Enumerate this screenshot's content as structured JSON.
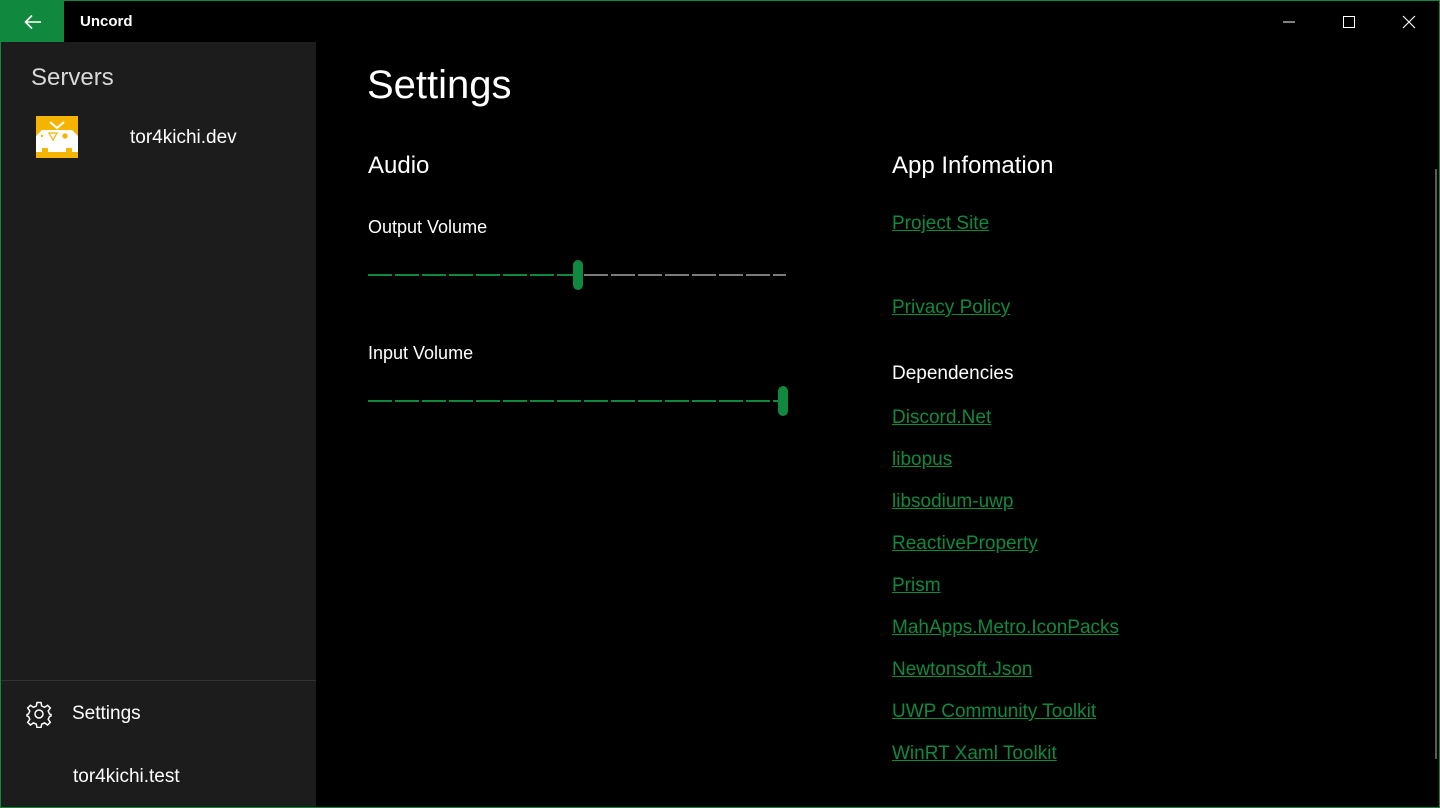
{
  "window": {
    "title": "Uncord",
    "accent_color": "#10893e"
  },
  "sidebar": {
    "heading": "Servers",
    "servers": [
      {
        "name": "tor4kichi.dev",
        "icon": "server-avatar-image"
      }
    ],
    "settings_label": "Settings",
    "settings_icon": "gear-icon",
    "account_name": "tor4kichi.test"
  },
  "main": {
    "page_title": "Settings",
    "audio": {
      "title": "Audio",
      "output_volume_label": "Output Volume",
      "output_volume_value": 0.5,
      "input_volume_label": "Input Volume",
      "input_volume_value": 1.0
    },
    "app_info": {
      "title": "App Infomation",
      "project_site": "Project Site",
      "privacy_policy": "Privacy Policy",
      "dependencies_label": "Dependencies",
      "dependencies": [
        "Discord.Net",
        "libopus",
        "libsodium-uwp",
        "ReactiveProperty",
        "Prism",
        "MahApps.Metro.IconPacks",
        "Newtonsoft.Json",
        "UWP Community Toolkit",
        "WinRT Xaml Toolkit"
      ]
    }
  }
}
